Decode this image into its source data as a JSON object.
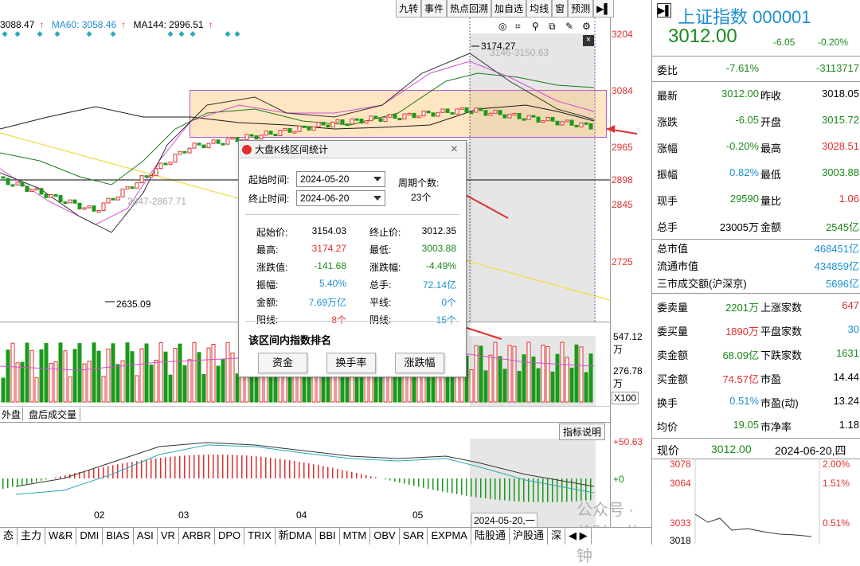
{
  "toolbar": [
    "九转",
    "事件",
    "热点回溯",
    "加自选",
    "均线",
    "窗",
    "预测"
  ],
  "ma": {
    "ma20": "3088.47",
    "ma60": "MA60: 3058.46",
    "ma144": "MA144: 2996.51"
  },
  "price_axis": [
    "3204",
    "3084",
    "2965",
    "2898",
    "2845",
    "2725"
  ],
  "chart_labels": {
    "high": "3174.27",
    "low": "2635.09",
    "ghost1": "3146-3150.63",
    "ghost2": "2847-2867.71"
  },
  "volume_axis": [
    "547.12万",
    "276.78万",
    "X100"
  ],
  "volume_tabs": [
    "外盘",
    "盘后成交量"
  ],
  "macd_axis": [
    "+50.63",
    "+0"
  ],
  "macd_btn": "指标说明",
  "date_labels": [
    "02",
    "03",
    "04",
    "05",
    "2024-05-20,一"
  ],
  "tabs": [
    "态",
    "主力",
    "W&R",
    "DMI",
    "BIAS",
    "ASI",
    "VR",
    "ARBR",
    "DPO",
    "TRIX",
    "新DMA",
    "BBI",
    "MTM",
    "OBV",
    "SAR",
    "EXPMA",
    "陆股通",
    "沪股通",
    "深"
  ],
  "dialog": {
    "title": "大盘K线区间统计",
    "start_label": "起始时间:",
    "start": "2024-05-20",
    "end_label": "终止时间:",
    "end": "2024-06-20",
    "period_label": "周期个数:",
    "period": "23个",
    "rows": [
      [
        "起始价:",
        "3154.03",
        "终止价:",
        "3012.35"
      ],
      [
        "最高:",
        "3174.27",
        "最低:",
        "3003.88"
      ],
      [
        "涨跌值:",
        "-141.68",
        "涨跌幅:",
        "-4.49%"
      ],
      [
        "振幅:",
        "5.40%",
        "总手:",
        "72.14亿"
      ],
      [
        "金额:",
        "7.69万亿",
        "平线:",
        "0个"
      ],
      [
        "阳线:",
        "8个",
        "阴线:",
        "15个"
      ]
    ],
    "rank_title": "该区间内指数排名",
    "buttons": [
      "资金",
      "换手率",
      "涨跌幅"
    ]
  },
  "panel": {
    "title": "上证指数 000001",
    "price": "3012.00",
    "change": "-6.05",
    "change_pct": "-0.20%",
    "rows1": [
      [
        "委比",
        "-7.61%",
        "",
        "-3113717"
      ]
    ],
    "rows2": [
      [
        "最新",
        "3012.00",
        "昨收",
        "3018.05"
      ],
      [
        "涨跌",
        "-6.05",
        "开盘",
        "3015.72"
      ],
      [
        "涨幅",
        "-0.20%",
        "最高",
        "3028.51"
      ],
      [
        "振幅",
        "0.82%",
        "最低",
        "3003.88"
      ],
      [
        "现手",
        "29590",
        "量比",
        "1.06"
      ],
      [
        "总手",
        "23005万",
        "金额",
        "2545亿"
      ]
    ],
    "rows3": [
      [
        "总市值",
        "468451亿"
      ],
      [
        "流通市值",
        "434859亿"
      ],
      [
        "三市成交额(沪深京)",
        "5696亿"
      ]
    ],
    "rows4": [
      [
        "委卖量",
        "2201万",
        "上涨家数",
        "647"
      ],
      [
        "委买量",
        "1890万",
        "平盘家数",
        "30"
      ],
      [
        "卖金额",
        "68.09亿",
        "下跌家数",
        "1631"
      ],
      [
        "买金额",
        "74.57亿",
        "市盈",
        "14.44"
      ],
      [
        "换手",
        "0.51%",
        "市盈(动)",
        "13.24"
      ],
      [
        "均价",
        "19.05",
        "市净率",
        "1.18"
      ]
    ],
    "now_label": "现价",
    "now_price": "3012.00",
    "now_date": "2024-06-20,四",
    "mini_axis_l": [
      "3078",
      "3064",
      "3033",
      "3018"
    ],
    "mini_axis_r": [
      "2.00%",
      "1.51%",
      "0.51%"
    ]
  },
  "watermark": "公众号 · 佳财一分钟"
}
